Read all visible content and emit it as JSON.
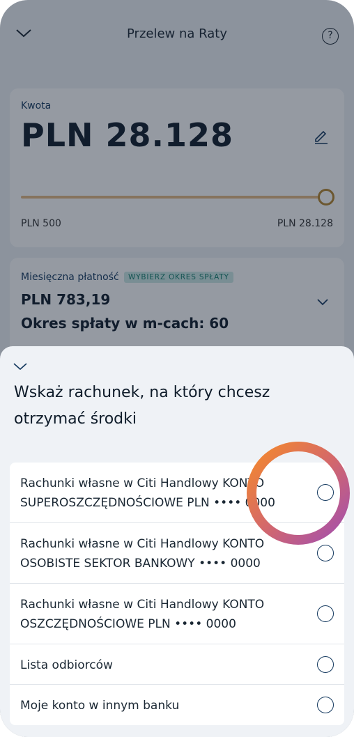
{
  "header": {
    "title": "Przelew na Raty",
    "help": "?"
  },
  "amount_card": {
    "label": "Kwota",
    "value": "PLN 28.128",
    "min_label": "PLN 500",
    "max_label": "PLN 28.128",
    "slider_fraction": 1.0
  },
  "monthly_card": {
    "label": "Miesięczna płatność",
    "badge": "WYBIERZ OKRES SPŁATY",
    "payment": "PLN 783,19",
    "period": "Okres spłaty w m-cach: 60"
  },
  "sheet": {
    "heading": "Wskaż rachunek, na który chcesz otrzymać środki",
    "options": [
      {
        "label": "Rachunki własne w Citi Handlowy KONTO SUPEROSZCZĘDNOŚCIOWE PLN •••• 0000",
        "selected": false
      },
      {
        "label": "Rachunki własne w Citi Handlowy KONTO OSOBISTE SEKTOR BANKOWY •••• 0000",
        "selected": false
      },
      {
        "label": "Rachunki własne w Citi Handlowy KONTO OSZCZĘDNOŚCIOWE PLN •••• 0000",
        "selected": false
      },
      {
        "label": "Lista odbiorców",
        "selected": false
      },
      {
        "label": "Moje konto w innym banku",
        "selected": false
      }
    ]
  },
  "colors": {
    "accent_navy": "#14395f",
    "badge_bg": "#cdeae6",
    "badge_text": "#17806f",
    "ring_orange": "#f58a2a",
    "ring_purple": "#a24fb0"
  },
  "icons": [
    "chevron-down-icon",
    "help-icon",
    "pencil-edit-icon",
    "radio-icon"
  ]
}
